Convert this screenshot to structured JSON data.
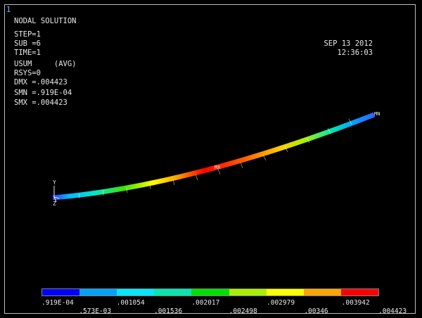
{
  "window": {
    "number": "1"
  },
  "header": {
    "title": "NODAL SOLUTION",
    "info": [
      "STEP=1",
      "SUB =6",
      "TIME=1",
      "USUM     (AVG)",
      "RSYS=0",
      "DMX =.004423",
      "SMN =.919E-04",
      "SMX =.004423"
    ],
    "date": "SEP 13 2012",
    "time": "12:36:03"
  },
  "markers": {
    "max": "MX",
    "min": "MN"
  },
  "triad": {
    "y": "Y",
    "z": "Z"
  },
  "legend": {
    "colors": [
      "#0000ff",
      "#00a2ff",
      "#00e8ff",
      "#00e8b0",
      "#00e000",
      "#a8f000",
      "#ffff00",
      "#ffa500",
      "#ff0000"
    ],
    "labels_top": [
      ".919E-04",
      ".001054",
      ".002017",
      ".002979",
      ".003942"
    ],
    "labels_bottom": [
      ".573E-03",
      ".001536",
      ".002498",
      ".00346",
      ".004423"
    ]
  }
}
